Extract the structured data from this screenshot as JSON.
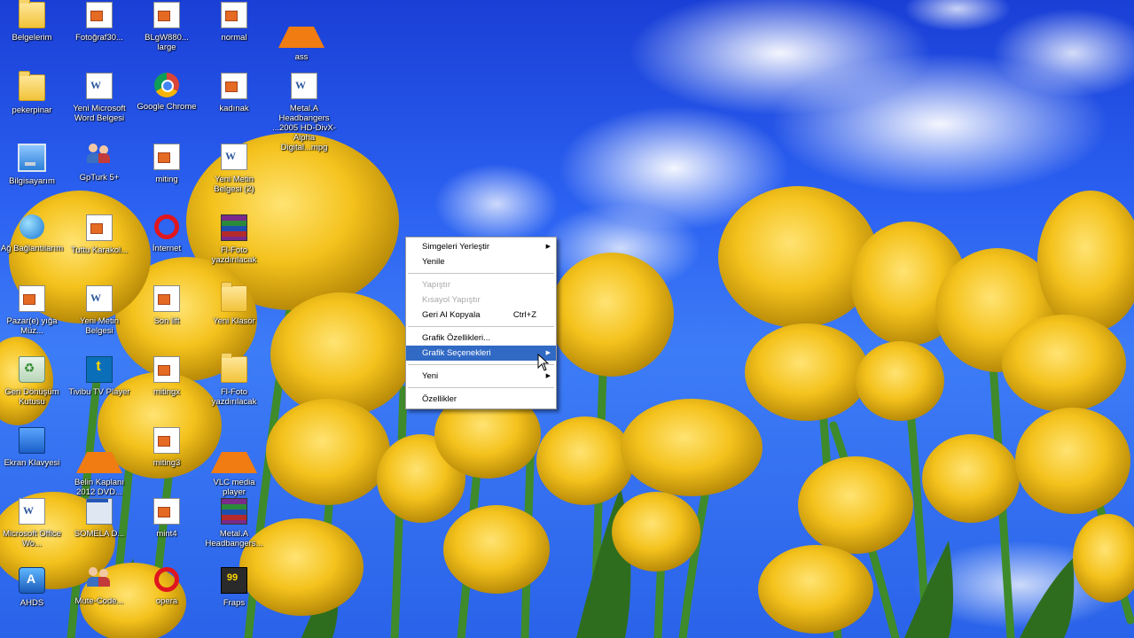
{
  "desktop": {
    "icons": [
      {
        "label": "Belgelerim",
        "icon": "folder-docs-icon"
      },
      {
        "label": "Fotoğraf30...",
        "icon": "document-icon"
      },
      {
        "label": "BLgW880... large",
        "icon": "document-icon"
      },
      {
        "label": "normal",
        "icon": "document-icon"
      },
      {
        "label": "ass",
        "icon": "vlc-icon"
      },
      {
        "label": "pekerpinar",
        "icon": "folder-icon"
      },
      {
        "label": "Yeni Microsoft Word Belgesi",
        "icon": "word-document-icon"
      },
      {
        "label": "Google Chrome",
        "icon": "chrome-icon"
      },
      {
        "label": "kadınak",
        "icon": "document-icon"
      },
      {
        "label": "Metal.A Headbangers ...2005 HD-DivX-Alpha Digital...mpg",
        "icon": "text-document-icon"
      },
      {
        "label": "Bilgisayarım",
        "icon": "computer-icon"
      },
      {
        "label": "GpTurk 5+",
        "icon": "users-icon"
      },
      {
        "label": "miting",
        "icon": "document-icon"
      },
      {
        "label": "Yeni Metin Belgesi (2)",
        "icon": "text-document-icon"
      },
      {
        "label": "Ağ Bağlantılarım",
        "icon": "network-icon"
      },
      {
        "label": "Tuttu Karakol...",
        "icon": "document-icon"
      },
      {
        "label": "İnternet",
        "icon": "opera-icon"
      },
      {
        "label": "Fl-Foto yazdırılacak",
        "icon": "winrar-icon"
      },
      {
        "label": "Pazar(e) yığa Müz...",
        "icon": "opera-doc-icon"
      },
      {
        "label": "Yeni Metin Belgesi",
        "icon": "text-document-icon"
      },
      {
        "label": "Son lift",
        "icon": "document-icon"
      },
      {
        "label": "Yeni Klasör",
        "icon": "folder-icon"
      },
      {
        "label": "Geri Dönüşüm Kutusu",
        "icon": "recycle-bin-icon"
      },
      {
        "label": "Tivibu TV Player",
        "icon": "tivibu-icon"
      },
      {
        "label": "mitingx",
        "icon": "document-icon"
      },
      {
        "label": "Fl-Foto yazdırılacak",
        "icon": "folder-icon"
      },
      {
        "label": "Ekran Klavyesi",
        "icon": "keyboard-icon"
      },
      {
        "label": "Belin Kaplanı 2012 DVD...",
        "icon": "vlc-icon"
      },
      {
        "label": "miting3",
        "icon": "document-icon"
      },
      {
        "label": "VLC media player",
        "icon": "vlc-icon"
      },
      {
        "label": "Microsoft Office Wo...",
        "icon": "word-document-icon"
      },
      {
        "label": "SOMELA D...",
        "icon": "app-window-icon"
      },
      {
        "label": "mint4",
        "icon": "document-icon"
      },
      {
        "label": "Metal.A Headbangers...",
        "icon": "winrar-icon"
      },
      {
        "label": "AHDS",
        "icon": "app-a-icon"
      },
      {
        "label": "Mute-Code...",
        "icon": "users-icon"
      },
      {
        "label": "opera",
        "icon": "opera-icon"
      },
      {
        "label": "Fraps",
        "icon": "fraps-icon"
      }
    ]
  },
  "context_menu": {
    "items": [
      {
        "label": "Simgeleri Yerleştir",
        "state": "normal",
        "submenu": true
      },
      {
        "label": "Yenile",
        "state": "normal"
      },
      {
        "label": "Yapıştır",
        "state": "disabled"
      },
      {
        "label": "Kısayol Yapıştır",
        "state": "disabled"
      },
      {
        "label": "Geri Al Kopyala",
        "state": "normal",
        "shortcut": "Ctrl+Z"
      },
      {
        "label": "Grafik Özellikleri...",
        "state": "normal"
      },
      {
        "label": "Grafik Seçenekleri",
        "state": "active",
        "submenu": true
      },
      {
        "label": "Yeni",
        "state": "normal",
        "submenu": true
      },
      {
        "label": "Özellikler",
        "state": "normal"
      }
    ],
    "submenu_arrow": "▶"
  },
  "colors": {
    "menu_highlight": "#316ac5",
    "sky": "#2a5ff0",
    "tulip": "#f4c21c"
  }
}
